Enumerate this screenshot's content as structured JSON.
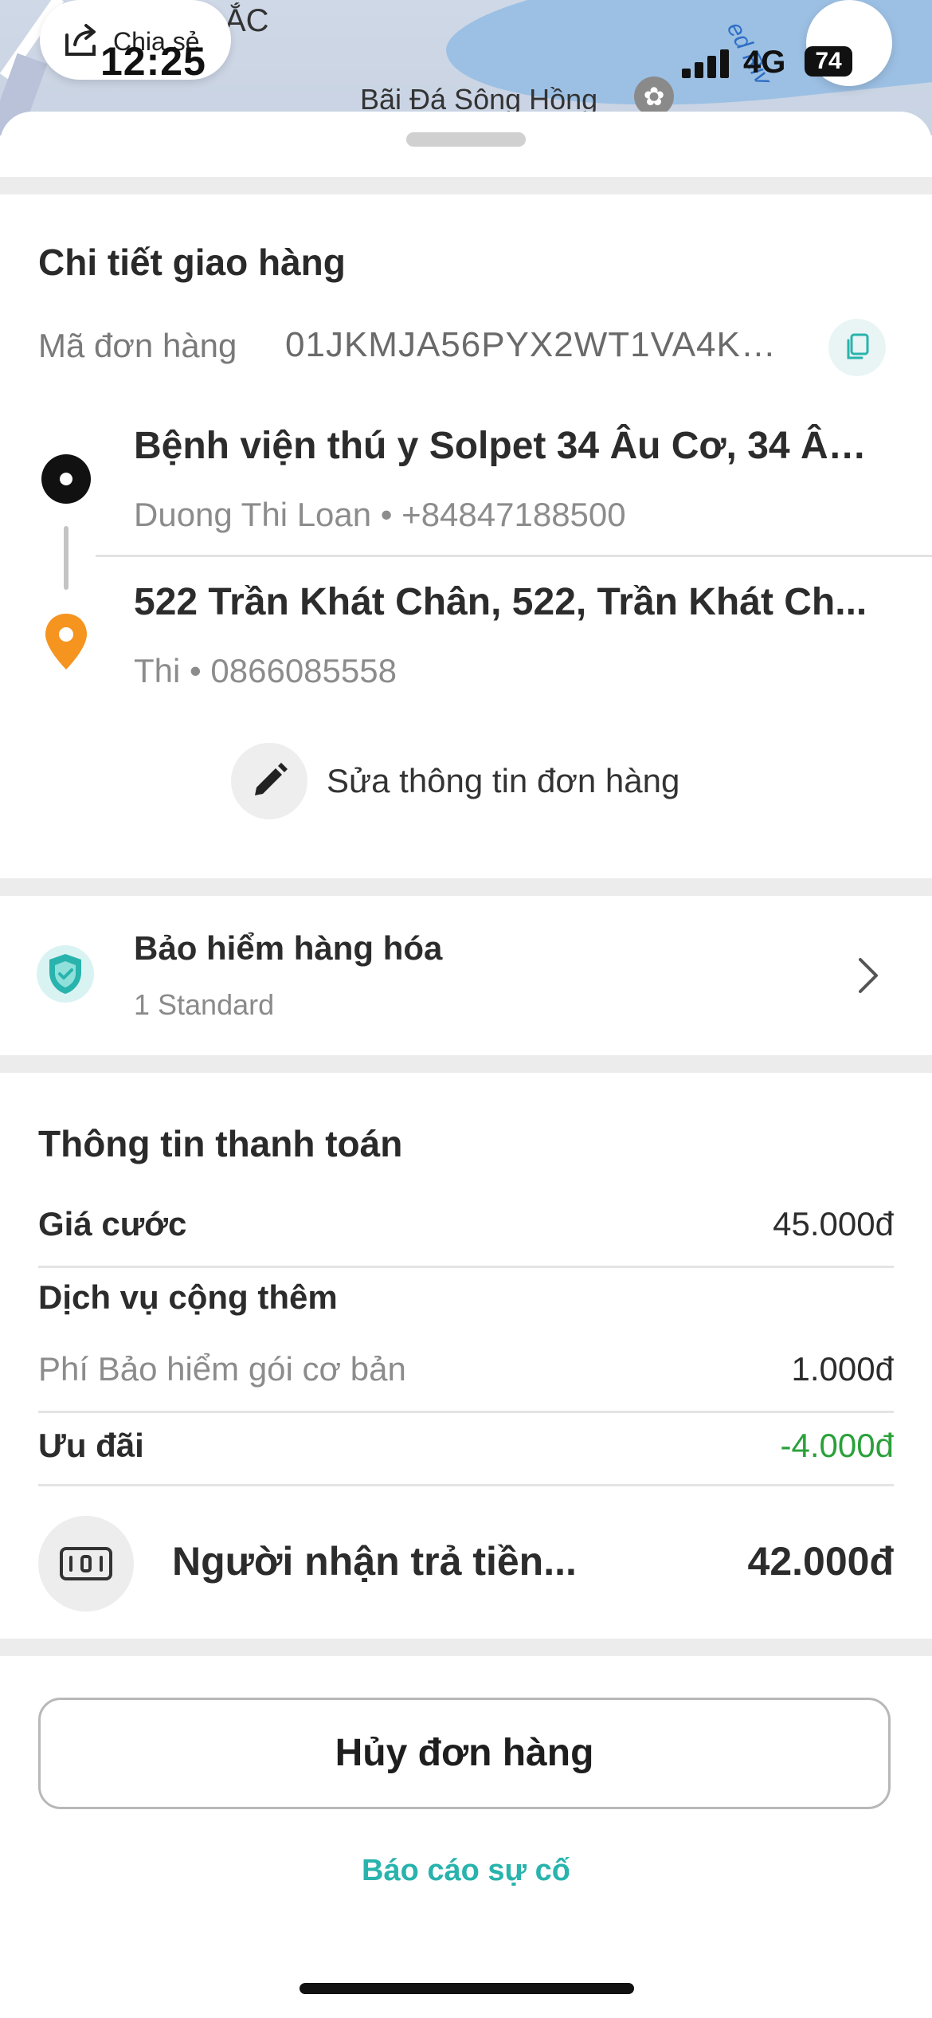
{
  "status_bar": {
    "time": "12:25",
    "network": "4G",
    "battery": "74"
  },
  "map": {
    "share_label": "Chia sẻ",
    "place_label": "Bãi Đá Sông Hồng",
    "river_label": "ed Riv",
    "partial_label": "ẮC"
  },
  "delivery": {
    "title": "Chi tiết giao hàng",
    "order_label": "Mã đơn hàng",
    "order_code": "01JKMJA56PYX2WT1VA4KG...",
    "pickup": {
      "address": "Bệnh viện thú y Solpet 34 Âu Cơ, 34 Âu...",
      "contact": "Duong Thi Loan • +84847188500"
    },
    "dropoff": {
      "address": "522 Trần Khát Chân, 522, Trần Khát Ch...",
      "contact": "Thi • 0866085558"
    },
    "edit_label": "Sửa thông tin đơn hàng"
  },
  "insurance": {
    "title": "Bảo hiểm hàng hóa",
    "subtitle": "1 Standard"
  },
  "payment": {
    "title": "Thông tin thanh toán",
    "fare_label": "Giá cước",
    "fare_value": "45.000đ",
    "extras_label": "Dịch vụ cộng thêm",
    "insurance_fee_label": "Phí Bảo hiểm gói cơ bản",
    "insurance_fee_value": "1.000đ",
    "discount_label": "Ưu đãi",
    "discount_value": "-4.000đ",
    "payer_label": "Người nhận trả tiền...",
    "total_value": "42.000đ"
  },
  "actions": {
    "cancel_label": "Hủy đơn hàng",
    "report_label": "Báo cáo sự cố"
  },
  "colors": {
    "accent": "#29b3ad",
    "discount": "#2aa13a",
    "pin": "#f5941f"
  }
}
